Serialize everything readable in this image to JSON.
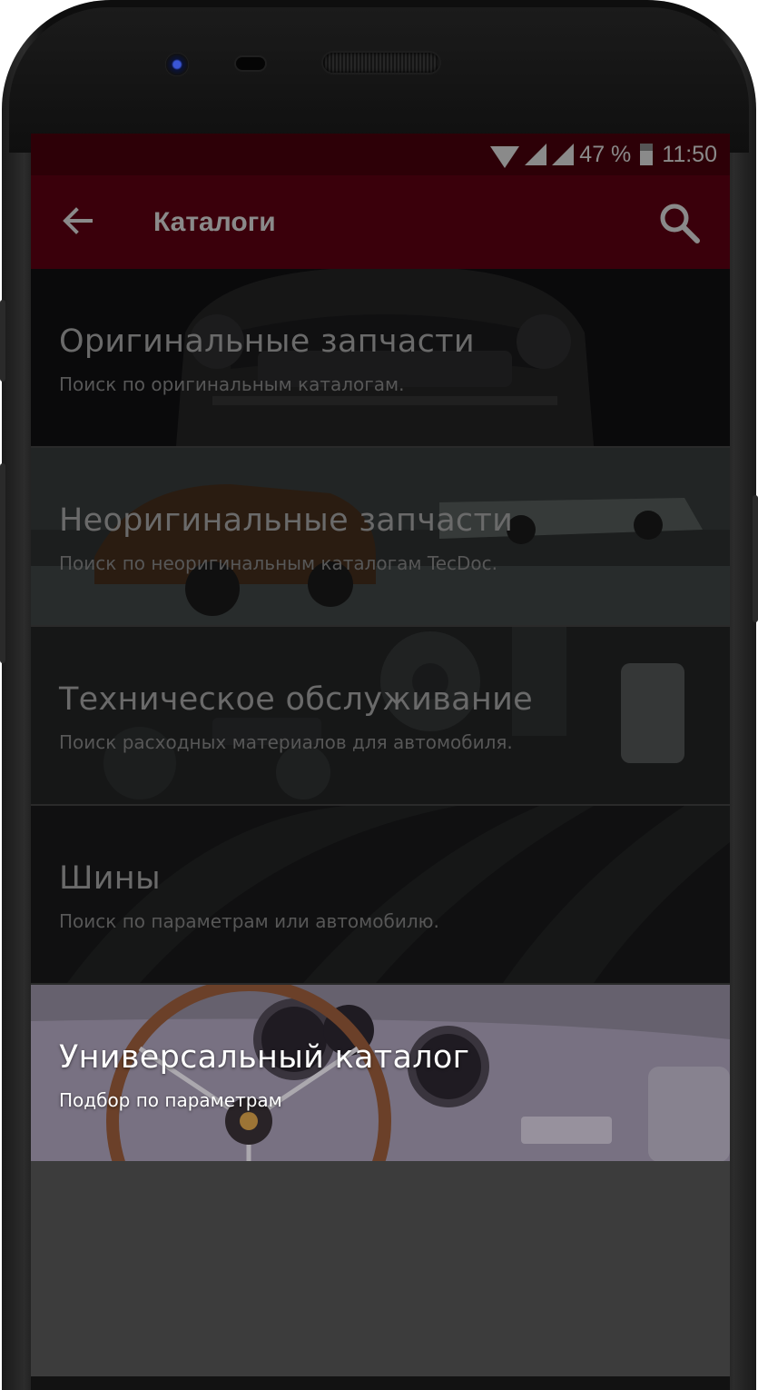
{
  "status_bar": {
    "battery_text": "47 %",
    "time": "11:50",
    "icons": [
      "wifi-icon",
      "cell-signal-icon",
      "cell-signal-icon",
      "battery-icon"
    ],
    "background": "#2d0007"
  },
  "app_bar": {
    "title": "Каталоги",
    "back_icon": "arrow-left-icon",
    "search_icon": "search-icon",
    "background": "#3a000b"
  },
  "catalogs": [
    {
      "title": "Оригинальные запчасти",
      "subtitle": "Поиск по оригинальным каталогам.",
      "image": "classic-car-front",
      "active": false
    },
    {
      "title": "Неоригинальные запчасти",
      "subtitle": "Поиск по неоригинальным каталогам TecDoc.",
      "image": "garage-workshop",
      "active": false
    },
    {
      "title": "Техническое обслуживание",
      "subtitle": "Поиск расходных материалов для автомобиля.",
      "image": "car-parts",
      "active": false
    },
    {
      "title": "Шины",
      "subtitle": "Поиск по параметрам или автомобилю.",
      "image": "tire-tread",
      "active": false
    },
    {
      "title": "Универсальный каталог",
      "subtitle": "Подбор по параметрам",
      "image": "dashboard-steering-wheel",
      "active": true
    }
  ]
}
